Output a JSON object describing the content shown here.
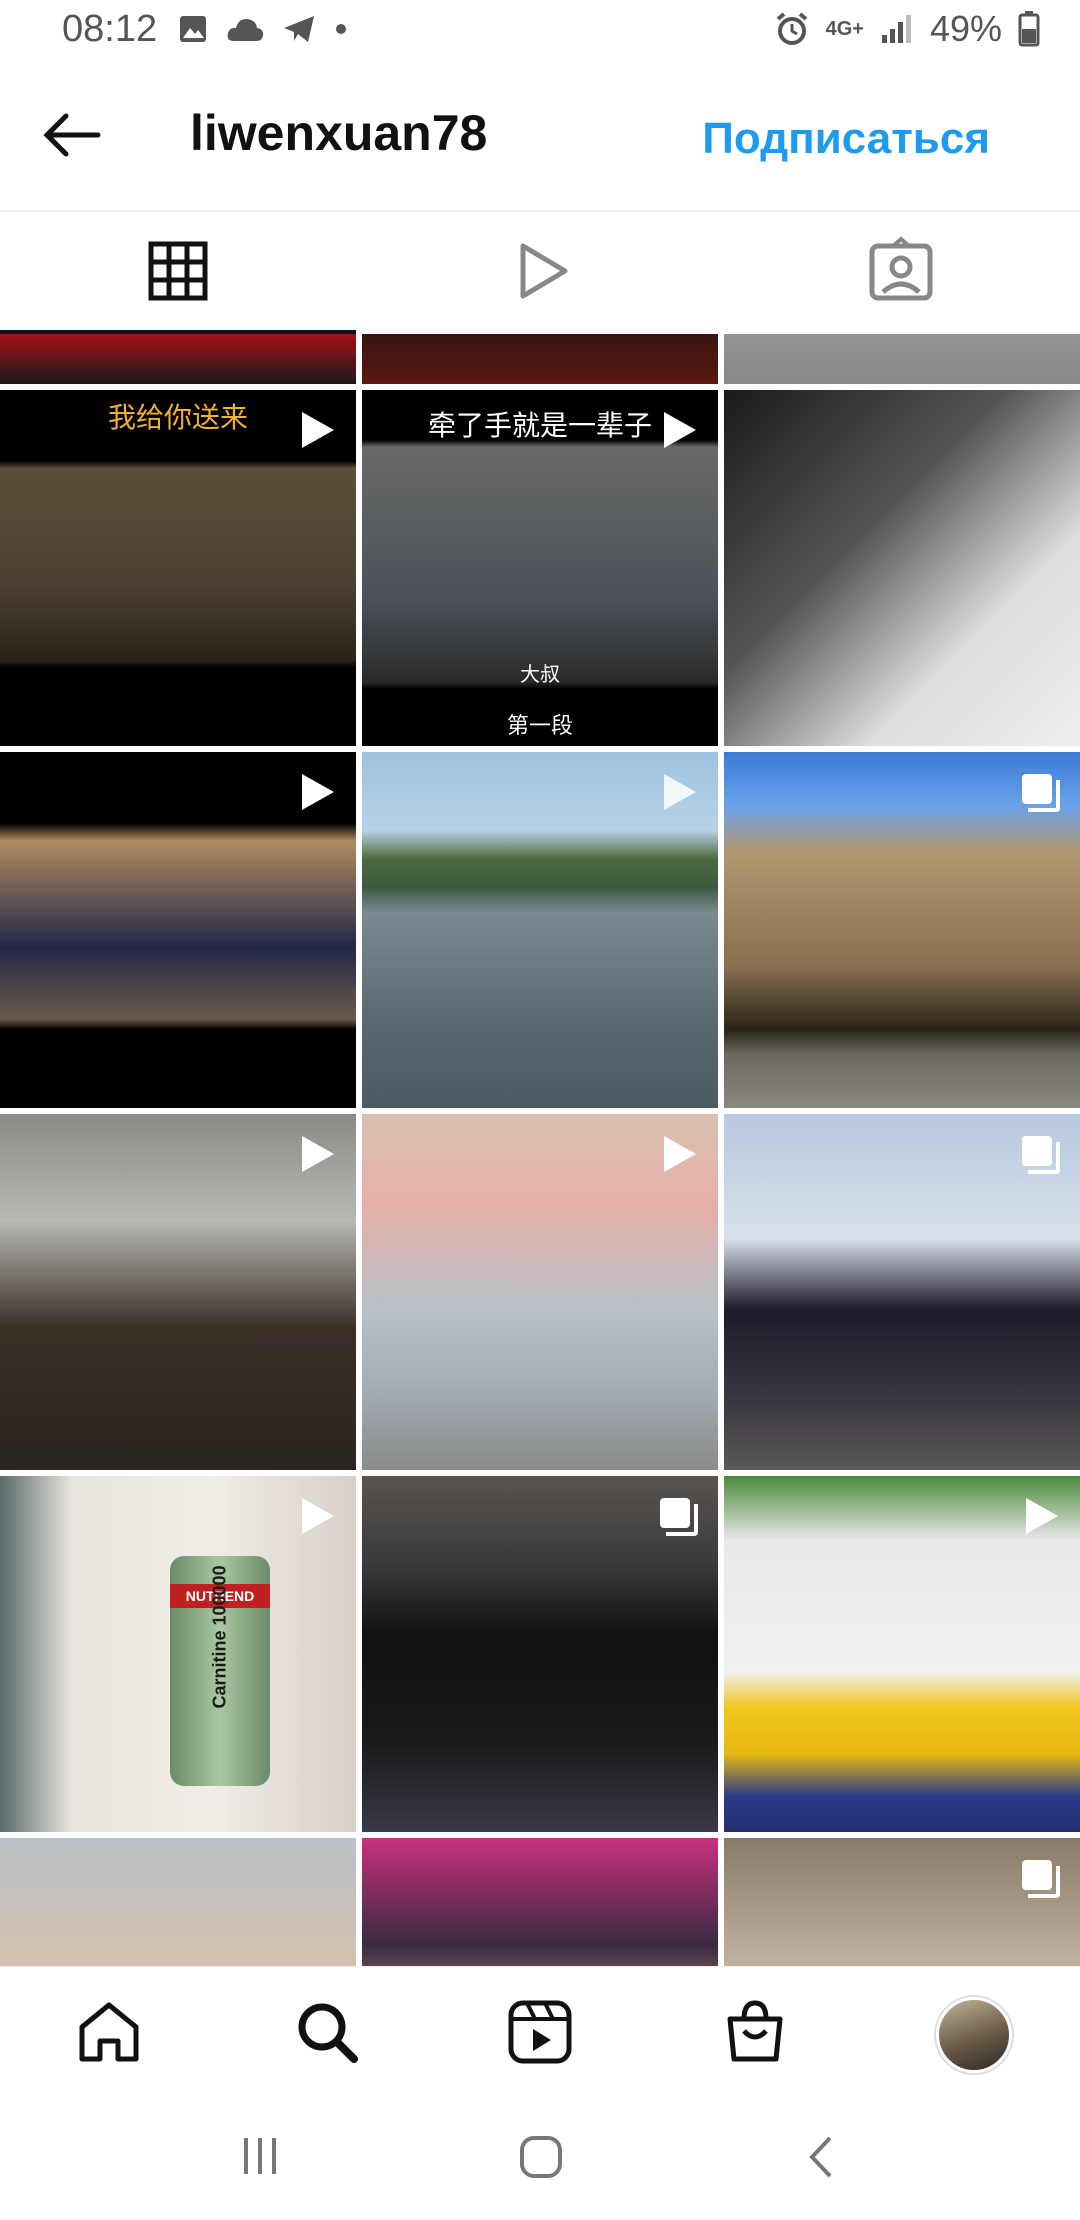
{
  "status_bar": {
    "time": "08:12",
    "network": "4G+",
    "battery": "49%"
  },
  "header": {
    "username": "liwenxuan78",
    "follow_label": "Подписаться"
  },
  "tabs": [
    {
      "icon": "grid-icon",
      "active": true
    },
    {
      "icon": "reels-icon",
      "active": false
    },
    {
      "icon": "tagged-icon",
      "active": false
    }
  ],
  "grid": {
    "rows": [
      [
        {
          "type": "image"
        },
        {
          "type": "image"
        },
        {
          "type": "image"
        }
      ],
      [
        {
          "type": "video",
          "caption_top": "我给你送来"
        },
        {
          "type": "video",
          "caption_top": "牵了手就是一辈子",
          "caption_mid": "大叔",
          "caption_bottom": "第一段"
        },
        {
          "type": "image"
        }
      ],
      [
        {
          "type": "video"
        },
        {
          "type": "video"
        },
        {
          "type": "carousel"
        }
      ],
      [
        {
          "type": "video"
        },
        {
          "type": "video"
        },
        {
          "type": "carousel"
        }
      ],
      [
        {
          "type": "video",
          "label": "Carnitine 100000",
          "brand": "NUTREND"
        },
        {
          "type": "carousel"
        },
        {
          "type": "video"
        }
      ],
      [
        {
          "type": "image"
        },
        {
          "type": "image"
        },
        {
          "type": "carousel"
        }
      ]
    ]
  },
  "bottom_nav": [
    "home-icon",
    "search-icon",
    "reels-icon",
    "shop-icon",
    "profile-avatar"
  ],
  "colors": {
    "accent": "#1d9bf0",
    "text": "#111111"
  }
}
